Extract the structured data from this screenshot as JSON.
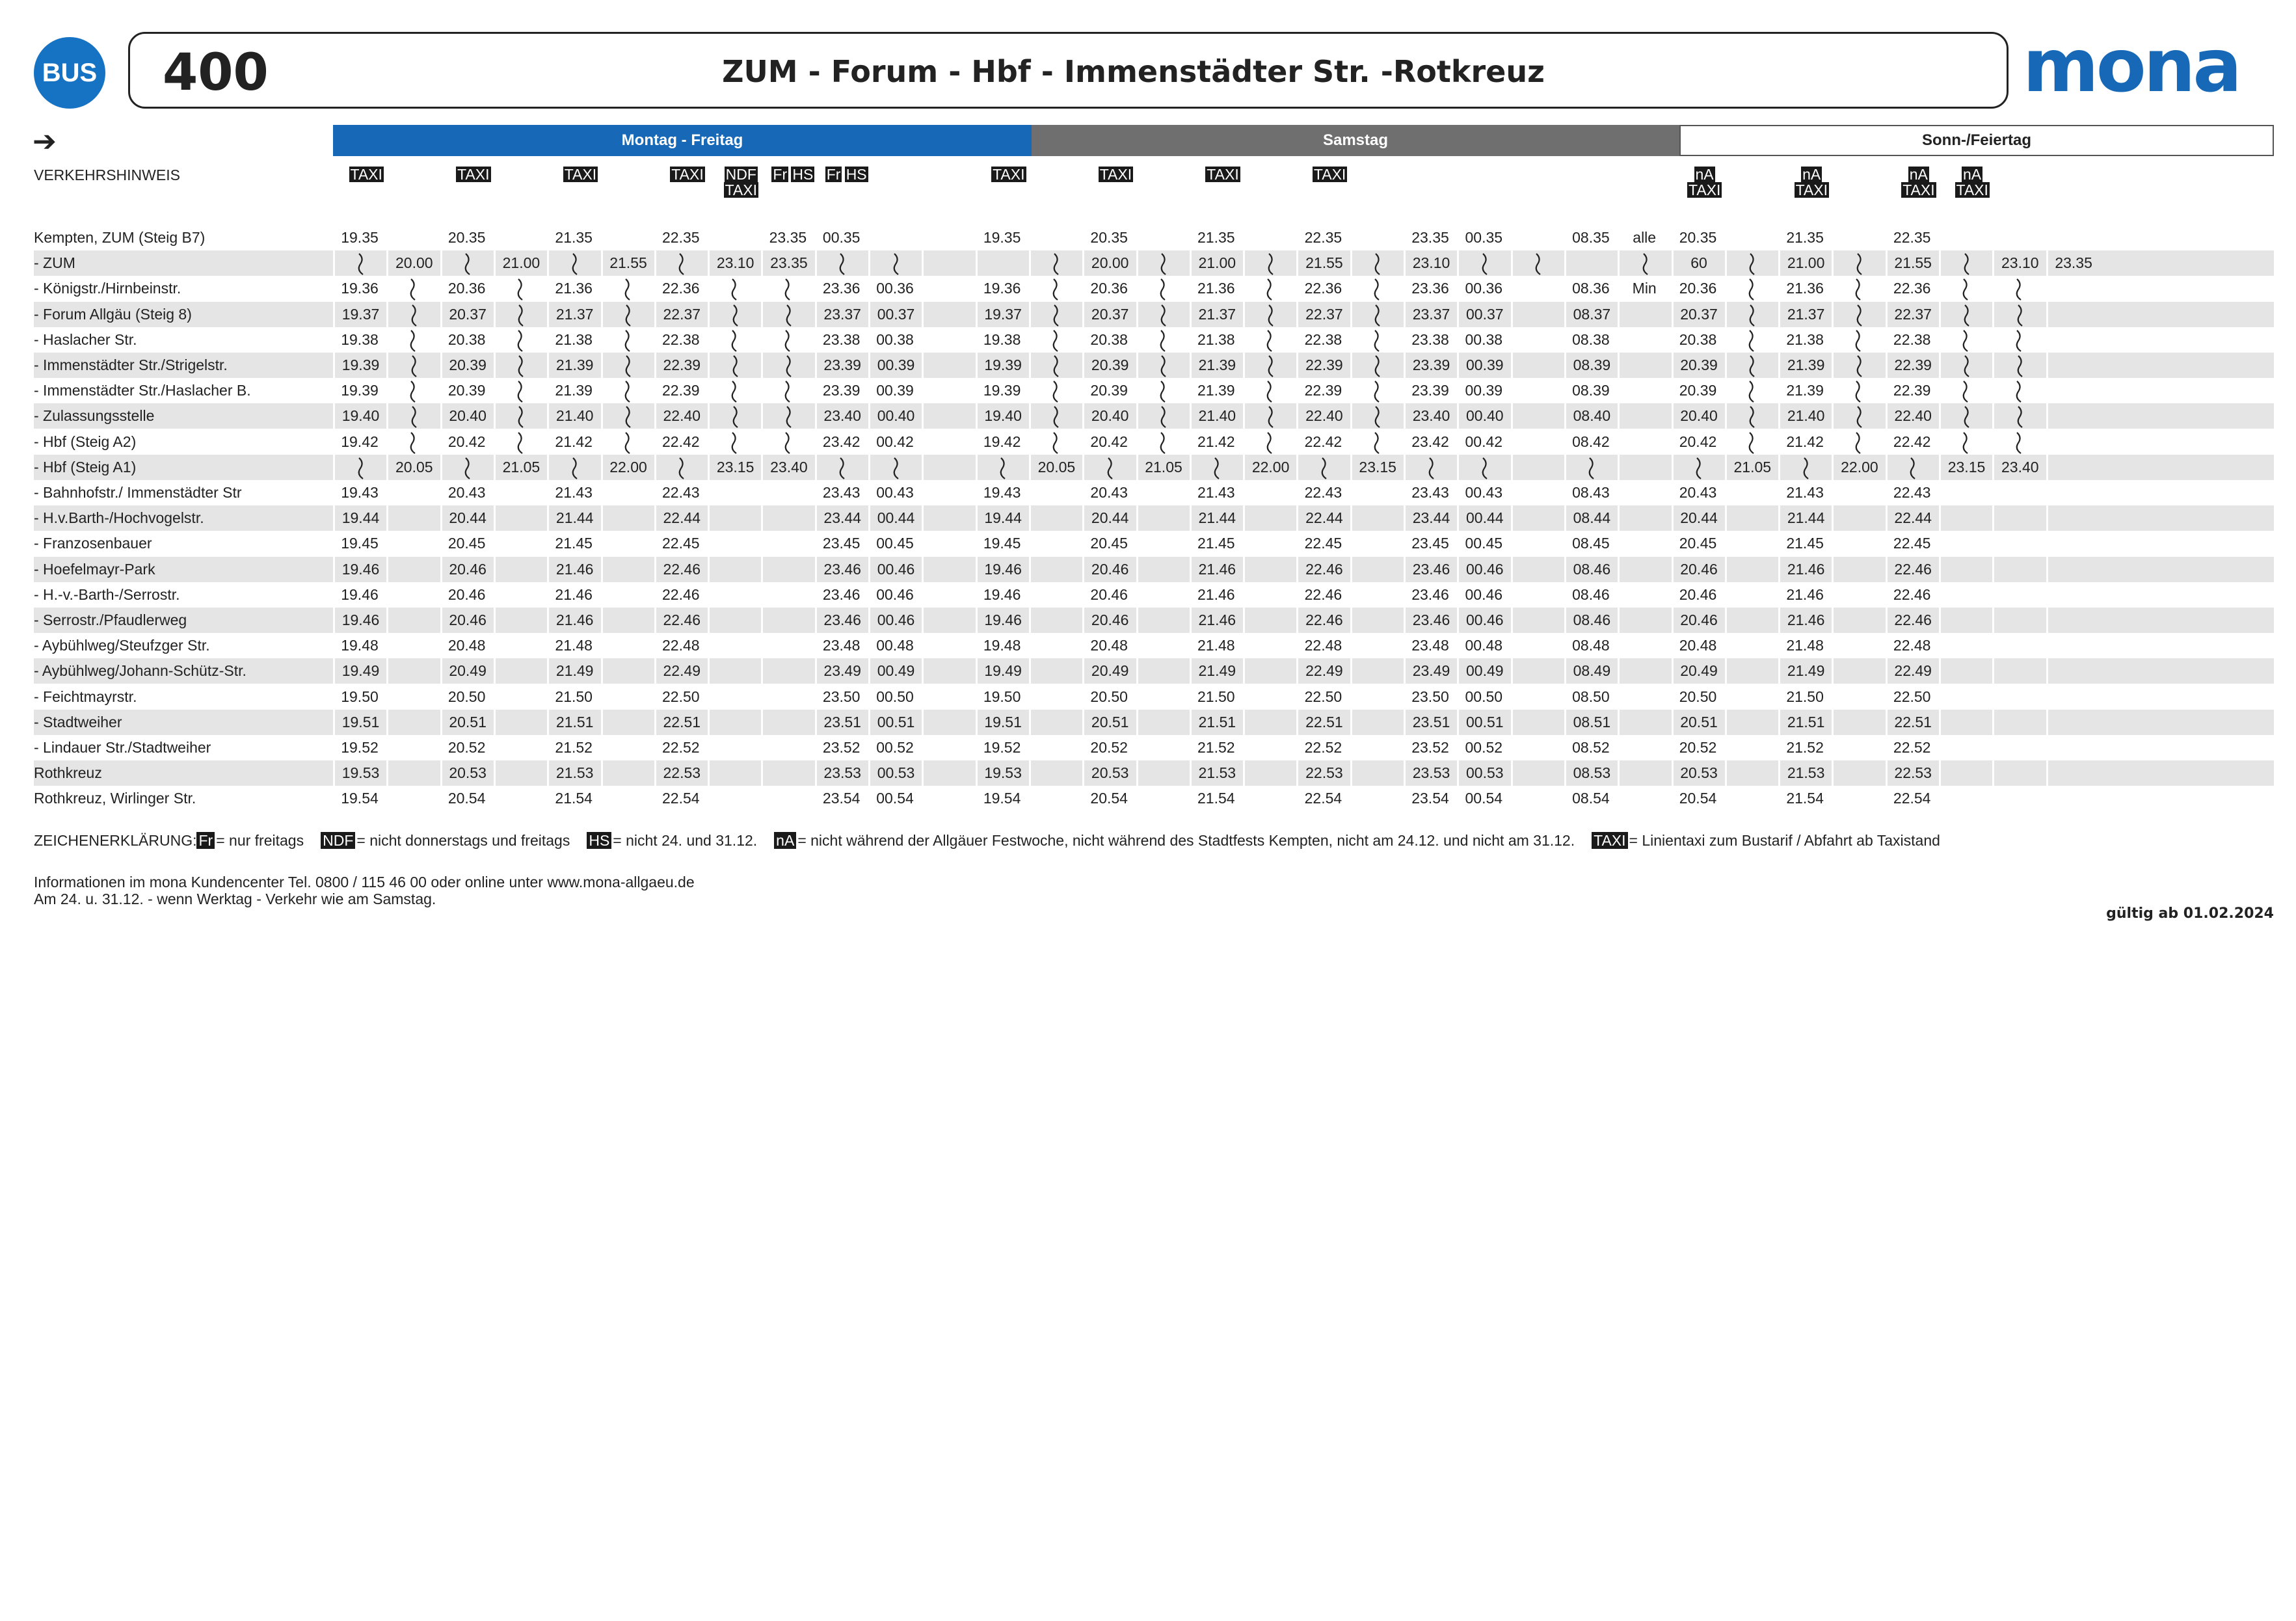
{
  "header": {
    "bus_label": "BUS",
    "line_number": "400",
    "route_title": "ZUM - Forum - Hbf - Immenstädter Str. -Rotkreuz",
    "logo_text": "mona",
    "brand_color": "#1769b7"
  },
  "day_headers": [
    "Montag - Freitag",
    "Samstag",
    "Sonn-/Feiertag"
  ],
  "notes_label": "VERKEHRSHINWEIS",
  "columns": [
    {
      "n": [
        "TAXI"
      ]
    },
    {
      "n": []
    },
    {
      "n": [
        "TAXI"
      ]
    },
    {
      "n": []
    },
    {
      "n": [
        "TAXI"
      ]
    },
    {
      "n": []
    },
    {
      "n": [
        "TAXI"
      ]
    },
    {
      "n": [
        "NDF",
        "TAXI"
      ]
    },
    {
      "n": [
        "Fr",
        "HS"
      ]
    },
    {
      "n": [
        "Fr",
        "HS"
      ]
    },
    {
      "n": []
    },
    {
      "n": []
    },
    {
      "n": [
        "TAXI"
      ]
    },
    {
      "n": []
    },
    {
      "n": [
        "TAXI"
      ]
    },
    {
      "n": []
    },
    {
      "n": [
        "TAXI"
      ]
    },
    {
      "n": []
    },
    {
      "n": [
        "TAXI"
      ]
    },
    {
      "n": []
    },
    {
      "n": []
    },
    {
      "n": []
    },
    {
      "n": []
    },
    {
      "n": []
    },
    {
      "n": []
    },
    {
      "n": [
        "nA",
        "TAXI"
      ]
    },
    {
      "n": []
    },
    {
      "n": [
        "nA",
        "TAXI"
      ]
    },
    {
      "n": []
    },
    {
      "n": [
        "nA",
        "TAXI"
      ]
    },
    {
      "n": [
        "nA",
        "TAXI"
      ]
    },
    {
      "n": []
    },
    {
      "n": []
    }
  ],
  "stops": [
    {
      "name": "Kempten, ZUM (Steig B7)",
      "t": [
        "19.35",
        "",
        "20.35",
        "",
        "21.35",
        "",
        "22.35",
        "",
        "23.35",
        "00.35",
        "",
        "",
        "19.35",
        "",
        "20.35",
        "",
        "21.35",
        "",
        "22.35",
        "",
        "23.35",
        "00.35",
        "",
        "08.35",
        "alle",
        "20.35",
        "",
        "21.35",
        "",
        "22.35",
        "",
        "",
        "",
        ""
      ]
    },
    {
      "name": "- ZUM",
      "t": [
        "~",
        "20.00",
        "~",
        "21.00",
        "~",
        "21.55",
        "~",
        "23.10",
        "23.35",
        "~",
        "~",
        "",
        "",
        "~",
        "20.00",
        "~",
        "21.00",
        "~",
        "21.55",
        "~",
        "23.10",
        "~",
        "~",
        "",
        "~",
        "60",
        "~",
        "21.00",
        "~",
        "21.55",
        "~",
        "23.10",
        "23.35"
      ]
    },
    {
      "name": "- Königstr./Hirnbeinstr.",
      "t": [
        "19.36",
        "~",
        "20.36",
        "~",
        "21.36",
        "~",
        "22.36",
        "~",
        "~",
        "23.36",
        "00.36",
        "",
        "19.36",
        "~",
        "20.36",
        "~",
        "21.36",
        "~",
        "22.36",
        "~",
        "23.36",
        "00.36",
        "",
        "08.36",
        "Min",
        "20.36",
        "~",
        "21.36",
        "~",
        "22.36",
        "~",
        "~",
        ""
      ]
    },
    {
      "name": "- Forum Allgäu (Steig 8)",
      "t": [
        "19.37",
        "~",
        "20.37",
        "~",
        "21.37",
        "~",
        "22.37",
        "~",
        "~",
        "23.37",
        "00.37",
        "",
        "19.37",
        "~",
        "20.37",
        "~",
        "21.37",
        "~",
        "22.37",
        "~",
        "23.37",
        "00.37",
        "",
        "08.37",
        "",
        "20.37",
        "~",
        "21.37",
        "~",
        "22.37",
        "~",
        "~",
        ""
      ]
    },
    {
      "name": "- Haslacher Str.",
      "t": [
        "19.38",
        "~",
        "20.38",
        "~",
        "21.38",
        "~",
        "22.38",
        "~",
        "~",
        "23.38",
        "00.38",
        "",
        "19.38",
        "~",
        "20.38",
        "~",
        "21.38",
        "~",
        "22.38",
        "~",
        "23.38",
        "00.38",
        "",
        "08.38",
        "",
        "20.38",
        "~",
        "21.38",
        "~",
        "22.38",
        "~",
        "~",
        ""
      ]
    },
    {
      "name": "- Immenstädter Str./Strigelstr.",
      "t": [
        "19.39",
        "~",
        "20.39",
        "~",
        "21.39",
        "~",
        "22.39",
        "~",
        "~",
        "23.39",
        "00.39",
        "",
        "19.39",
        "~",
        "20.39",
        "~",
        "21.39",
        "~",
        "22.39",
        "~",
        "23.39",
        "00.39",
        "",
        "08.39",
        "",
        "20.39",
        "~",
        "21.39",
        "~",
        "22.39",
        "~",
        "~",
        ""
      ]
    },
    {
      "name": "- Immenstädter Str./Haslacher B.",
      "t": [
        "19.39",
        "~",
        "20.39",
        "~",
        "21.39",
        "~",
        "22.39",
        "~",
        "~",
        "23.39",
        "00.39",
        "",
        "19.39",
        "~",
        "20.39",
        "~",
        "21.39",
        "~",
        "22.39",
        "~",
        "23.39",
        "00.39",
        "",
        "08.39",
        "",
        "20.39",
        "~",
        "21.39",
        "~",
        "22.39",
        "~",
        "~",
        ""
      ]
    },
    {
      "name": "- Zulassungsstelle",
      "t": [
        "19.40",
        "~",
        "20.40",
        "~",
        "21.40",
        "~",
        "22.40",
        "~",
        "~",
        "23.40",
        "00.40",
        "",
        "19.40",
        "~",
        "20.40",
        "~",
        "21.40",
        "~",
        "22.40",
        "~",
        "23.40",
        "00.40",
        "",
        "08.40",
        "",
        "20.40",
        "~",
        "21.40",
        "~",
        "22.40",
        "~",
        "~",
        ""
      ]
    },
    {
      "name": "- Hbf (Steig A2)",
      "t": [
        "19.42",
        "~",
        "20.42",
        "~",
        "21.42",
        "~",
        "22.42",
        "~",
        "~",
        "23.42",
        "00.42",
        "",
        "19.42",
        "~",
        "20.42",
        "~",
        "21.42",
        "~",
        "22.42",
        "~",
        "23.42",
        "00.42",
        "",
        "08.42",
        "",
        "20.42",
        "~",
        "21.42",
        "~",
        "22.42",
        "~",
        "~",
        ""
      ]
    },
    {
      "name": "- Hbf (Steig A1)",
      "t": [
        "~",
        "20.05",
        "~",
        "21.05",
        "~",
        "22.00",
        "~",
        "23.15",
        "23.40",
        "~",
        "~",
        "",
        "~",
        "20.05",
        "~",
        "21.05",
        "~",
        "22.00",
        "~",
        "23.15",
        "~",
        "~",
        "",
        "~",
        "",
        "~",
        "21.05",
        "~",
        "22.00",
        "~",
        "23.15",
        "23.40",
        ""
      ]
    },
    {
      "name": "- Bahnhofstr./ Immenstädter Str",
      "t": [
        "19.43",
        "",
        "20.43",
        "",
        "21.43",
        "",
        "22.43",
        "",
        "",
        "23.43",
        "00.43",
        "",
        "19.43",
        "",
        "20.43",
        "",
        "21.43",
        "",
        "22.43",
        "",
        "23.43",
        "00.43",
        "",
        "08.43",
        "",
        "20.43",
        "",
        "21.43",
        "",
        "22.43",
        "",
        "",
        ""
      ]
    },
    {
      "name": "- H.v.Barth-/Hochvogelstr.",
      "t": [
        "19.44",
        "",
        "20.44",
        "",
        "21.44",
        "",
        "22.44",
        "",
        "",
        "23.44",
        "00.44",
        "",
        "19.44",
        "",
        "20.44",
        "",
        "21.44",
        "",
        "22.44",
        "",
        "23.44",
        "00.44",
        "",
        "08.44",
        "",
        "20.44",
        "",
        "21.44",
        "",
        "22.44",
        "",
        "",
        ""
      ]
    },
    {
      "name": "- Franzosenbauer",
      "t": [
        "19.45",
        "",
        "20.45",
        "",
        "21.45",
        "",
        "22.45",
        "",
        "",
        "23.45",
        "00.45",
        "",
        "19.45",
        "",
        "20.45",
        "",
        "21.45",
        "",
        "22.45",
        "",
        "23.45",
        "00.45",
        "",
        "08.45",
        "",
        "20.45",
        "",
        "21.45",
        "",
        "22.45",
        "",
        "",
        ""
      ]
    },
    {
      "name": "- Hoefelmayr-Park",
      "t": [
        "19.46",
        "",
        "20.46",
        "",
        "21.46",
        "",
        "22.46",
        "",
        "",
        "23.46",
        "00.46",
        "",
        "19.46",
        "",
        "20.46",
        "",
        "21.46",
        "",
        "22.46",
        "",
        "23.46",
        "00.46",
        "",
        "08.46",
        "",
        "20.46",
        "",
        "21.46",
        "",
        "22.46",
        "",
        "",
        ""
      ]
    },
    {
      "name": "- H.-v.-Barth-/Serrostr.",
      "t": [
        "19.46",
        "",
        "20.46",
        "",
        "21.46",
        "",
        "22.46",
        "",
        "",
        "23.46",
        "00.46",
        "",
        "19.46",
        "",
        "20.46",
        "",
        "21.46",
        "",
        "22.46",
        "",
        "23.46",
        "00.46",
        "",
        "08.46",
        "",
        "20.46",
        "",
        "21.46",
        "",
        "22.46",
        "",
        "",
        ""
      ]
    },
    {
      "name": "- Serrostr./Pfaudlerweg",
      "t": [
        "19.46",
        "",
        "20.46",
        "",
        "21.46",
        "",
        "22.46",
        "",
        "",
        "23.46",
        "00.46",
        "",
        "19.46",
        "",
        "20.46",
        "",
        "21.46",
        "",
        "22.46",
        "",
        "23.46",
        "00.46",
        "",
        "08.46",
        "",
        "20.46",
        "",
        "21.46",
        "",
        "22.46",
        "",
        "",
        ""
      ]
    },
    {
      "name": "- Aybühlweg/Steufzger Str.",
      "t": [
        "19.48",
        "",
        "20.48",
        "",
        "21.48",
        "",
        "22.48",
        "",
        "",
        "23.48",
        "00.48",
        "",
        "19.48",
        "",
        "20.48",
        "",
        "21.48",
        "",
        "22.48",
        "",
        "23.48",
        "00.48",
        "",
        "08.48",
        "",
        "20.48",
        "",
        "21.48",
        "",
        "22.48",
        "",
        "",
        ""
      ]
    },
    {
      "name": "- Aybühlweg/Johann-Schütz-Str.",
      "t": [
        "19.49",
        "",
        "20.49",
        "",
        "21.49",
        "",
        "22.49",
        "",
        "",
        "23.49",
        "00.49",
        "",
        "19.49",
        "",
        "20.49",
        "",
        "21.49",
        "",
        "22.49",
        "",
        "23.49",
        "00.49",
        "",
        "08.49",
        "",
        "20.49",
        "",
        "21.49",
        "",
        "22.49",
        "",
        "",
        ""
      ]
    },
    {
      "name": "- Feichtmayrstr.",
      "t": [
        "19.50",
        "",
        "20.50",
        "",
        "21.50",
        "",
        "22.50",
        "",
        "",
        "23.50",
        "00.50",
        "",
        "19.50",
        "",
        "20.50",
        "",
        "21.50",
        "",
        "22.50",
        "",
        "23.50",
        "00.50",
        "",
        "08.50",
        "",
        "20.50",
        "",
        "21.50",
        "",
        "22.50",
        "",
        "",
        ""
      ]
    },
    {
      "name": "- Stadtweiher",
      "t": [
        "19.51",
        "",
        "20.51",
        "",
        "21.51",
        "",
        "22.51",
        "",
        "",
        "23.51",
        "00.51",
        "",
        "19.51",
        "",
        "20.51",
        "",
        "21.51",
        "",
        "22.51",
        "",
        "23.51",
        "00.51",
        "",
        "08.51",
        "",
        "20.51",
        "",
        "21.51",
        "",
        "22.51",
        "",
        "",
        ""
      ]
    },
    {
      "name": "- Lindauer Str./Stadtweiher",
      "t": [
        "19.52",
        "",
        "20.52",
        "",
        "21.52",
        "",
        "22.52",
        "",
        "",
        "23.52",
        "00.52",
        "",
        "19.52",
        "",
        "20.52",
        "",
        "21.52",
        "",
        "22.52",
        "",
        "23.52",
        "00.52",
        "",
        "08.52",
        "",
        "20.52",
        "",
        "21.52",
        "",
        "22.52",
        "",
        "",
        ""
      ]
    },
    {
      "name": "Rothkreuz",
      "t": [
        "19.53",
        "",
        "20.53",
        "",
        "21.53",
        "",
        "22.53",
        "",
        "",
        "23.53",
        "00.53",
        "",
        "19.53",
        "",
        "20.53",
        "",
        "21.53",
        "",
        "22.53",
        "",
        "23.53",
        "00.53",
        "",
        "08.53",
        "",
        "20.53",
        "",
        "21.53",
        "",
        "22.53",
        "",
        "",
        ""
      ]
    },
    {
      "name": "Rothkreuz, Wirlinger Str.",
      "t": [
        "19.54",
        "",
        "20.54",
        "",
        "21.54",
        "",
        "22.54",
        "",
        "",
        "23.54",
        "00.54",
        "",
        "19.54",
        "",
        "20.54",
        "",
        "21.54",
        "",
        "22.54",
        "",
        "23.54",
        "00.54",
        "",
        "08.54",
        "",
        "20.54",
        "",
        "21.54",
        "",
        "22.54",
        "",
        "",
        ""
      ]
    }
  ],
  "legend": {
    "title": "ZEICHENERKLÄRUNG:",
    "items": [
      {
        "code": "Fr",
        "text": "= nur freitags"
      },
      {
        "code": "NDF",
        "text": "= nicht donnerstags und freitags"
      },
      {
        "code": "HS",
        "text": "= nicht 24. und 31.12."
      },
      {
        "code": "nA",
        "text": "= nicht während der Allgäuer Festwoche, nicht während des Stadtfests Kempten, nicht am 24.12. und nicht am 31.12."
      },
      {
        "code": "TAXI",
        "text": "= Linientaxi zum Bustarif / Abfahrt ab Taxistand"
      }
    ]
  },
  "info": {
    "line1": "Informationen im mona Kundencenter Tel. 0800 / 115 46 00 oder online unter www.mona-allgaeu.de",
    "line2": "Am 24. u. 31.12. - wenn Werktag - Verkehr wie am Samstag.",
    "valid": "gültig ab 01.02.2024"
  }
}
